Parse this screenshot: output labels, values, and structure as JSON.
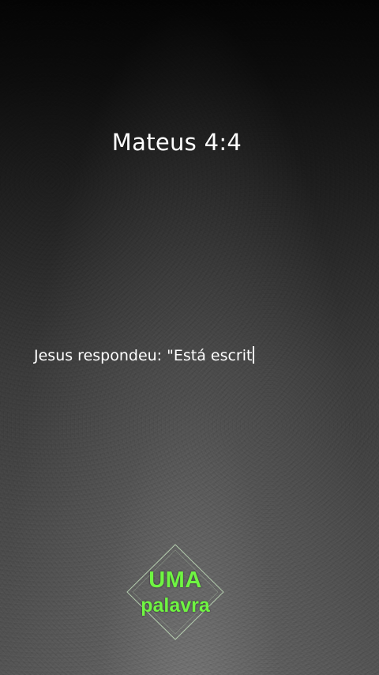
{
  "verse": {
    "reference": "Mateus 4:4",
    "text": "Jesus respondeu: \"Está escrit"
  },
  "logo": {
    "line1": "UMA",
    "line2": "palavra",
    "text_color": "#6ff542",
    "outline_color": "#c8e6c0"
  }
}
